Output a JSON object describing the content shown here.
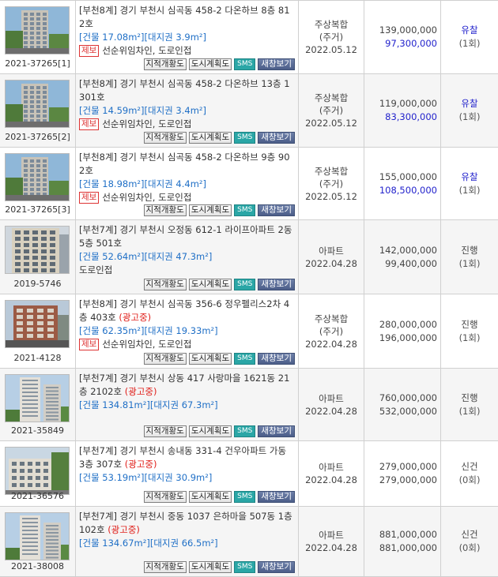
{
  "buttons": {
    "cadastral": "지적개황도",
    "urban_plan": "도시계획도",
    "sms": "SMS",
    "new_window": "새창보기"
  },
  "rows": [
    {
      "case_no": "2021-37265[1]",
      "address": "[부천8계] 경기 부천시 심곡동 458-2 다온하브 8층 812호",
      "ad": "",
      "area": "[건물 17.08m²][대지권 3.9m²]",
      "jebo": "제보",
      "note": "선순위임차인, 도로인접",
      "type_line1": "주상복합",
      "type_line2": "(주거)",
      "date": "2022.05.12",
      "appraisal": "139,000,000",
      "min_price": "97,300,000",
      "status": "유찰",
      "rounds": "(1회)",
      "photo": "building"
    },
    {
      "case_no": "2021-37265[2]",
      "address": "[부천8계] 경기 부천시 심곡동 458-2 다온하브 13층 1301호",
      "ad": "",
      "area": "[건물 14.59m²][대지권 3.4m²]",
      "jebo": "제보",
      "note": "선순위임차인, 도로인접",
      "type_line1": "주상복합",
      "type_line2": "(주거)",
      "date": "2022.05.12",
      "appraisal": "119,000,000",
      "min_price": "83,300,000",
      "status": "유찰",
      "rounds": "(1회)",
      "photo": "building"
    },
    {
      "case_no": "2021-37265[3]",
      "address": "[부천8계] 경기 부천시 심곡동 458-2 다온하브 9층 902호",
      "ad": "",
      "area": "[건물 18.98m²][대지권 4.4m²]",
      "jebo": "제보",
      "note": "선순위임차인, 도로인접",
      "type_line1": "주상복합",
      "type_line2": "(주거)",
      "date": "2022.05.12",
      "appraisal": "155,000,000",
      "min_price": "108,500,000",
      "status": "유찰",
      "rounds": "(1회)",
      "photo": "building"
    },
    {
      "case_no": "2019-5746",
      "address": "[부천7계] 경기 부천시 오정동 612-1 라이프아파트 2동 5층 501호",
      "ad": "",
      "area": "[건물 52.64m²][대지권 47.3m²]",
      "jebo": "",
      "note": "도로인접",
      "type_line1": "아파트",
      "type_line2": "",
      "date": "2022.04.28",
      "appraisal": "142,000,000",
      "min_price": "99,400,000",
      "status": "진행",
      "rounds": "(1회)",
      "photo": "apartment"
    },
    {
      "case_no": "2021-4128",
      "address": "[부천8계] 경기 부천시 심곡동 356-6 정우펠리스2차 4층 403호",
      "ad": "(광고중)",
      "area": "[건물 62.35m²][대지권 19.33m²]",
      "jebo": "제보",
      "note": "선순위임차인, 도로인접",
      "type_line1": "주상복합",
      "type_line2": "(주거)",
      "date": "2022.04.28",
      "appraisal": "280,000,000",
      "min_price": "196,000,000",
      "status": "진행",
      "rounds": "(1회)",
      "photo": "brick"
    },
    {
      "case_no": "2021-35849",
      "address": "[부천7계] 경기 부천시 상동 417 사랑마을 1621동 21층 2102호",
      "ad": "(광고중)",
      "area": "[건물 134.81m²][대지권 67.3m²]",
      "jebo": "",
      "note": "",
      "type_line1": "아파트",
      "type_line2": "",
      "date": "2022.04.28",
      "appraisal": "760,000,000",
      "min_price": "532,000,000",
      "status": "진행",
      "rounds": "(1회)",
      "photo": "tower"
    },
    {
      "case_no": "2021-36576",
      "address": "[부천7계] 경기 부천시 송내동 331-4 건우아파트 가동 3층 307호",
      "ad": "(광고중)",
      "area": "[건물 53.19m²][대지권 30.9m²]",
      "jebo": "",
      "note": "",
      "type_line1": "아파트",
      "type_line2": "",
      "date": "2022.04.28",
      "appraisal": "279,000,000",
      "min_price": "279,000,000",
      "status": "신건",
      "rounds": "(0회)",
      "photo": "lowrise"
    },
    {
      "case_no": "2021-38008",
      "address": "[부천7계] 경기 부천시 중동 1037 은하마을 507동 1층 102호",
      "ad": "(광고중)",
      "area": "[건물 134.67m²][대지권 66.5m²]",
      "jebo": "",
      "note": "",
      "type_line1": "아파트",
      "type_line2": "",
      "date": "2022.04.28",
      "appraisal": "881,000,000",
      "min_price": "881,000,000",
      "status": "신건",
      "rounds": "(0회)",
      "photo": "tower"
    }
  ]
}
